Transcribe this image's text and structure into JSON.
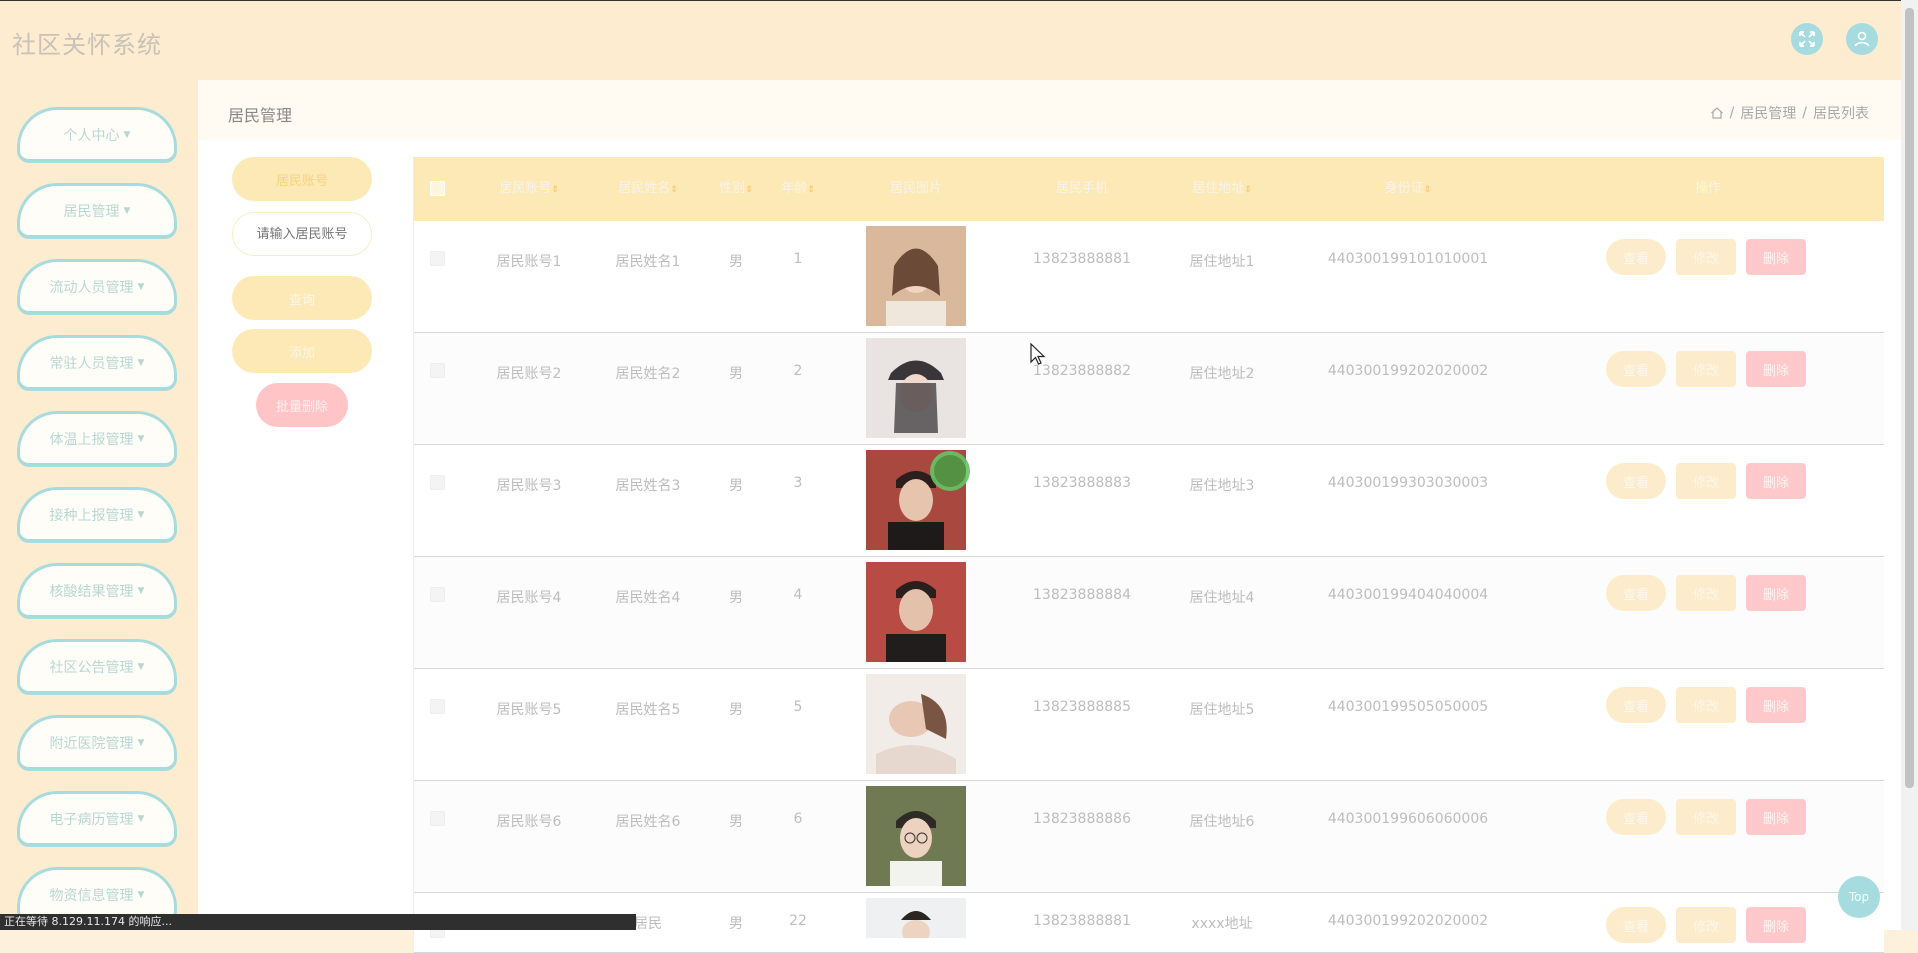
{
  "app": {
    "title": "社区关怀系统"
  },
  "sidebar": {
    "items": [
      {
        "label": "个人中心"
      },
      {
        "label": "居民管理"
      },
      {
        "label": "流动人员管理"
      },
      {
        "label": "常驻人员管理"
      },
      {
        "label": "体温上报管理"
      },
      {
        "label": "接种上报管理"
      },
      {
        "label": "核酸结果管理"
      },
      {
        "label": "社区公告管理"
      },
      {
        "label": "附近医院管理"
      },
      {
        "label": "电子病历管理"
      },
      {
        "label": "物资信息管理"
      }
    ]
  },
  "page": {
    "title": "居民管理",
    "breadcrumb": [
      "居民管理",
      "居民列表"
    ]
  },
  "search": {
    "label": "居民账号",
    "placeholder": "请输入居民账号",
    "query_label": "查询",
    "add_label": "添加",
    "batch_delete_label": "批量删除"
  },
  "table": {
    "columns": [
      "居民账号",
      "居民姓名",
      "性别",
      "年龄",
      "居民图片",
      "居民手机",
      "居住地址",
      "身份证",
      "操作"
    ],
    "actions": {
      "view": "查看",
      "edit": "修改",
      "delete": "删除"
    },
    "rows": [
      {
        "account": "居民账号1",
        "name": "居民姓名1",
        "gender": "男",
        "age": "1",
        "phone": "13823888881",
        "address": "居住地址1",
        "id_card": "440300199101010001"
      },
      {
        "account": "居民账号2",
        "name": "居民姓名2",
        "gender": "男",
        "age": "2",
        "phone": "13823888882",
        "address": "居住地址2",
        "id_card": "440300199202020002"
      },
      {
        "account": "居民账号3",
        "name": "居民姓名3",
        "gender": "男",
        "age": "3",
        "phone": "13823888883",
        "address": "居住地址3",
        "id_card": "440300199303030003"
      },
      {
        "account": "居民账号4",
        "name": "居民姓名4",
        "gender": "男",
        "age": "4",
        "phone": "13823888884",
        "address": "居住地址4",
        "id_card": "440300199404040004"
      },
      {
        "account": "居民账号5",
        "name": "居民姓名5",
        "gender": "男",
        "age": "5",
        "phone": "13823888885",
        "address": "居住地址5",
        "id_card": "440300199505050005"
      },
      {
        "account": "居民账号6",
        "name": "居民姓名6",
        "gender": "男",
        "age": "6",
        "phone": "13823888886",
        "address": "居住地址6",
        "id_card": "440300199606060006"
      },
      {
        "account": "",
        "name": "居民",
        "gender": "男",
        "age": "22",
        "phone": "13823888881",
        "address": "xxxx地址",
        "id_card": "440300199202020002"
      }
    ]
  },
  "status_bar": {
    "text": "正在等待 8.129.11.174 的响应..."
  },
  "top_button": {
    "label": "Top"
  },
  "colors": {
    "accent_yellow": "#fde9b6",
    "accent_teal": "#a6dcdf",
    "danger": "#ffc4c6"
  }
}
